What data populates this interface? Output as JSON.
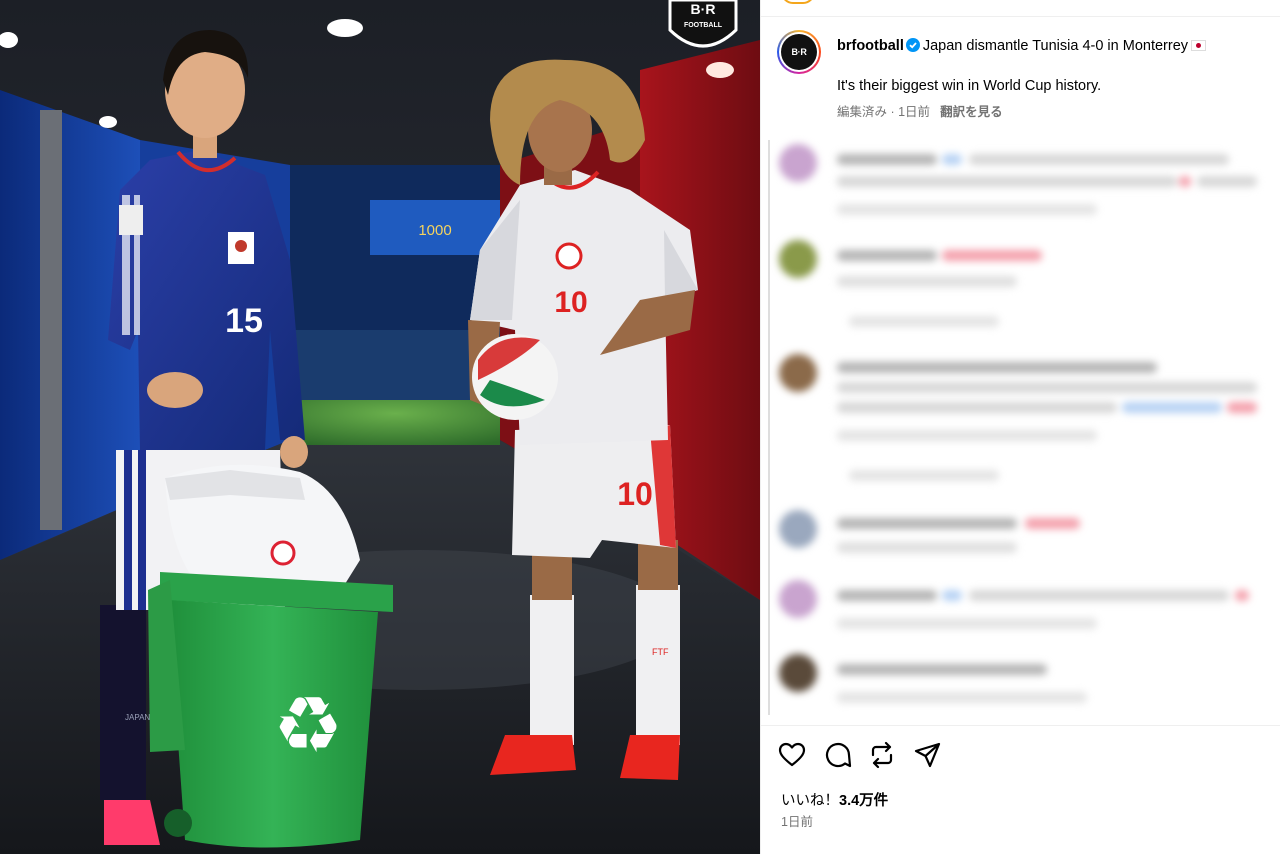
{
  "post": {
    "image": {
      "logo_top": "B·R",
      "logo_bottom": "FOOTBALL",
      "japan_number": "15",
      "japan_text": "JAPAN",
      "tunisia_number": "10",
      "tunisia_sock_text": "FTF"
    }
  },
  "caption": {
    "avatar_text": "B·R",
    "username": "brfootball",
    "headline": "Japan dismantle Tunisia 4-0 in Monterrey",
    "body": "It's their biggest win in World Cup history.",
    "meta": "編集済み · 1日前",
    "translate": "翻訳を見る"
  },
  "icons": {
    "like": "heart-icon",
    "comment": "comment-icon",
    "share": "repost-icon",
    "send": "send-icon",
    "verified": "verified-badge-icon"
  },
  "colors": {
    "verified": "#0095f6",
    "meta": "#737373",
    "ring": [
      "#f7b733",
      "#fc4a1a",
      "#d6249f",
      "#285aeb"
    ]
  },
  "stats": {
    "likes_label": "いいね！",
    "likes_count": "3.4万件",
    "date": "1日前"
  }
}
